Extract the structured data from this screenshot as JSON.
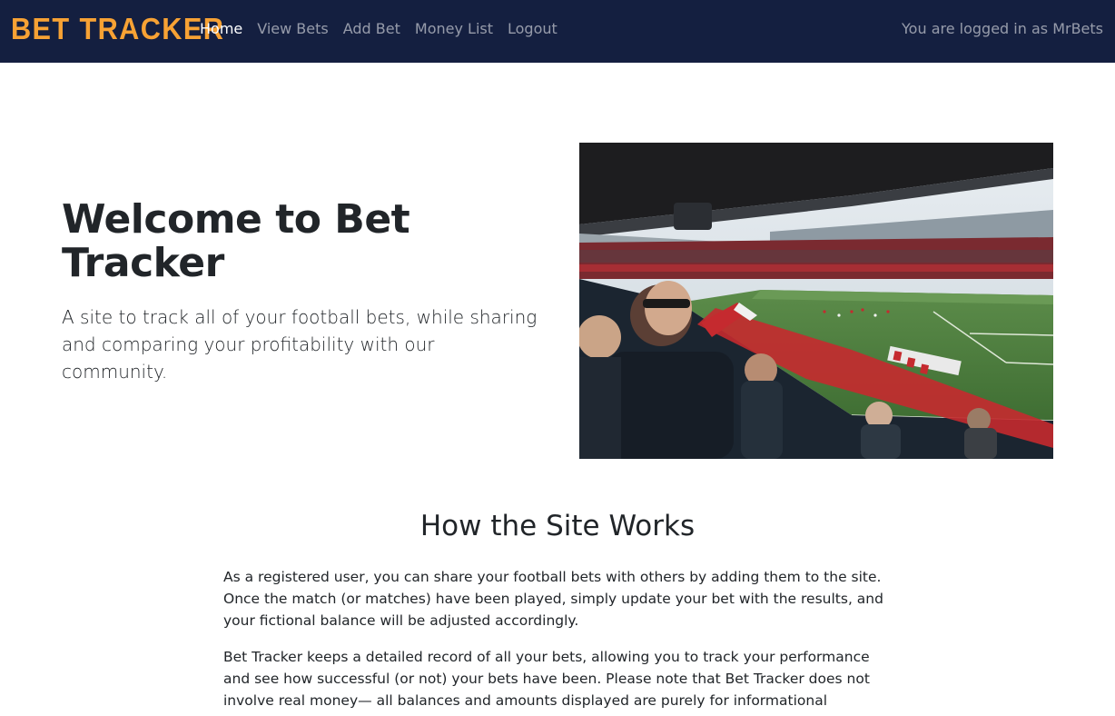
{
  "brand": "BET TRACKER",
  "nav": {
    "items": [
      {
        "label": "Home",
        "active": true
      },
      {
        "label": "View Bets",
        "active": false
      },
      {
        "label": "Add Bet",
        "active": false
      },
      {
        "label": "Money List",
        "active": false
      },
      {
        "label": "Logout",
        "active": false
      }
    ],
    "status": "You are logged in as MrBets"
  },
  "hero": {
    "title": "Welcome to Bet Tracker",
    "subtitle": "A site to track all of your football bets, while sharing and comparing your profitability with our community.",
    "image_subject": "football stadium crowd with fans holding red and white scarves"
  },
  "how_it_works": {
    "title": "How the Site Works",
    "paragraphs": [
      "As a registered user, you can share your football bets with others by adding them to the site. Once the match (or matches) have been played, simply update your bet with the results, and your fictional balance will be adjusted accordingly.",
      "Bet Tracker keeps a detailed record of all your bets, allowing you to track your performance and see how successful (or not) your bets have been. Please note that Bet Tracker does not involve real money— all balances and amounts displayed are purely for informational"
    ]
  },
  "colors": {
    "navbar_bg": "#141f40",
    "brand": "#f7a234",
    "nav_active": "#ffffff",
    "nav_inactive": "rgba(255,255,255,0.55)",
    "text": "#212529"
  }
}
